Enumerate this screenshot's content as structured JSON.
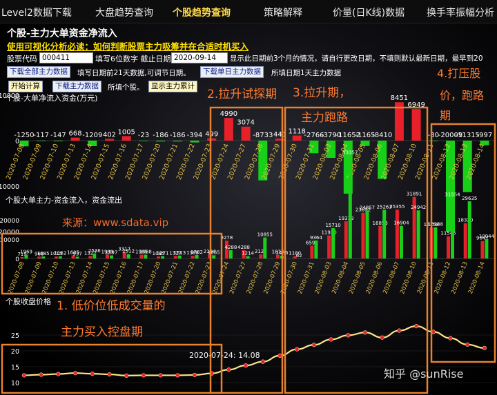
{
  "nav": {
    "items": [
      "Level2数据下载",
      "大盘趋势查询",
      "个股趋势查询",
      "策略解释",
      "价量(日K线)数据",
      "换手率振幅分析"
    ],
    "active_index": 2
  },
  "page": {
    "title": "个股-主力大单资金净流入",
    "guide_link": "使用可视化分析必读：如何判断股票主力吸筹并在合适时机买入"
  },
  "form": {
    "code_label": "股票代码",
    "code_value": "000411",
    "code_hint": "填写6位数字 截止日期",
    "date_value": "2020-09-14",
    "date_hint": "显示此日期前3个月的情况，请自行更改日期，不填则默认最新日期，最早到20",
    "btn_download_all": "下载全部主力数据",
    "hint_all": "填写日期前21天数据,可调节日期。",
    "btn_download_single": "下载单日主力数据",
    "hint_single": "所填日期1天主力数据",
    "btn_start": "开始计算",
    "btn_download_main": "下载主力数据",
    "hint_fill": "所填个股。",
    "btn_show_cum": "显示主力累计"
  },
  "annotations": {
    "source": "来源：www.sdata.vip",
    "phase1_line1": "1. 低价位低成交量的",
    "phase1_line2": "主力买入控盘期",
    "phase2": "2.拉升试探期",
    "phase3_line1": "3.拉升期，",
    "phase3_line2": "主力跑路",
    "phase4_line1": "4.打压股",
    "phase4_line2": "价，跑路",
    "phase4_line3": "期",
    "watermark": "知乎 @sunRise",
    "tooltip": "2020-07-24: 14.08"
  },
  "colors": {
    "pos": "#e8202a",
    "neg": "#19d019",
    "price_line": "#ffe58a",
    "price_dot": "#e8202a",
    "axis_text": "#e6c34a",
    "annotation": "#ff7a2e",
    "box": "#e8822e",
    "sell": "#ff2020"
  },
  "chart_data": [
    {
      "type": "bar",
      "title": "个股-大单净流入资金(万元)",
      "categories": [
        "2020-07-08",
        "2020-07-09",
        "2020-07-10",
        "2020-07-13",
        "2020-07-14",
        "2020-07-15",
        "2020-07-16",
        "2020-07-17",
        "2020-07-20",
        "2020-07-21",
        "2020-07-22",
        "2020-07-23",
        "2020-07-24",
        "2020-07-27",
        "2020-07-28",
        "2020-07-29",
        "2020-07-30",
        "2020-07-31",
        "2020-08-03",
        "2020-08-04",
        "2020-08-05",
        "2020-08-06",
        "2020-08-07",
        "2020-08-10",
        "2020-08-11",
        "2020-08-12",
        "2020-08-13",
        "2020-08-14"
      ],
      "values": [
        -1250,
        -117,
        -147,
        668,
        -1209,
        402,
        1005,
        -23,
        -186,
        -186,
        -394,
        499,
        4990,
        3074,
        -8733,
        441,
        1118,
        -2766,
        -3790,
        -11652,
        -1165,
        -8410,
        8451,
        6949,
        -30,
        -20009,
        -11315,
        -997
      ],
      "ylim": [
        -20000,
        10000
      ],
      "yticks": [
        -20000,
        -10000,
        0,
        10000
      ]
    },
    {
      "type": "bar",
      "title": "个股大单主力-资金流入，资金流出",
      "categories": [
        "2020-07-08",
        "2020-07-09",
        "2020-07-10",
        "2020-07-13",
        "2020-07-14",
        "2020-07-15",
        "2020-07-16",
        "2020-07-17",
        "2020-07-20",
        "2020-07-21",
        "2020-07-22",
        "2020-07-23",
        "2020-07-24",
        "2020-07-27",
        "2020-07-28",
        "2020-07-29",
        "2020-07-30",
        "2020-07-31",
        "2020-08-03",
        "2020-08-04",
        "2020-08-05",
        "2020-08-06",
        "2020-08-07",
        "2020-08-10",
        "2020-08-11",
        "2020-08-12",
        "2020-08-13",
        "2020-08-14"
      ],
      "series": [
        {
          "values": [
            719,
            968,
            1015,
            1605,
            1327,
            1999,
            3317,
            1965,
            1085,
            1327,
            1388,
            2164,
            9278,
            4288,
            2122,
            1877,
            1180,
            6598,
            11920,
            19313,
            23692,
            16853,
            25355,
            31891,
            16158,
            11545,
            18320,
            9047
          ]
        },
        {
          "values": [
            1969,
            1085,
            1162,
            937,
            2536,
            1597,
            2312,
            1988,
            1271,
            1513,
            1782,
            1665,
            4288,
            1214,
            10855,
            1436,
            62,
            9364,
            15710,
            53357,
            24857,
            25263,
            16904,
            24942,
            16188,
            31554,
            29635,
            10044
          ]
        }
      ],
      "ylim": [
        0,
        60000
      ],
      "yticks": [
        0,
        10000,
        20000
      ]
    },
    {
      "type": "line",
      "title": "个股收盘价格",
      "x": [
        "2020-07-08",
        "2020-07-09",
        "2020-07-10",
        "2020-07-13",
        "2020-07-14",
        "2020-07-15",
        "2020-07-16",
        "2020-07-17",
        "2020-07-20",
        "2020-07-21",
        "2020-07-22",
        "2020-07-23",
        "2020-07-24",
        "2020-07-27",
        "2020-07-28",
        "2020-07-29",
        "2020-07-30",
        "2020-07-31",
        "2020-08-03",
        "2020-08-04",
        "2020-08-05",
        "2020-08-06",
        "2020-08-07",
        "2020-08-10",
        "2020-08-11",
        "2020-08-12",
        "2020-08-13",
        "2020-08-14"
      ],
      "y": [
        12.3,
        12.5,
        12.7,
        13.0,
        12.8,
        12.6,
        12.2,
        12.3,
        12.3,
        12.3,
        12.4,
        12.9,
        14.08,
        15.4,
        16.6,
        18.5,
        20.5,
        21.9,
        23.6,
        24.9,
        25.8,
        24.2,
        26.4,
        27.8,
        26.0,
        24.0,
        22.0,
        20.9
      ],
      "ylim": [
        10,
        30
      ],
      "yticks": [
        10,
        15,
        20,
        25
      ]
    }
  ]
}
